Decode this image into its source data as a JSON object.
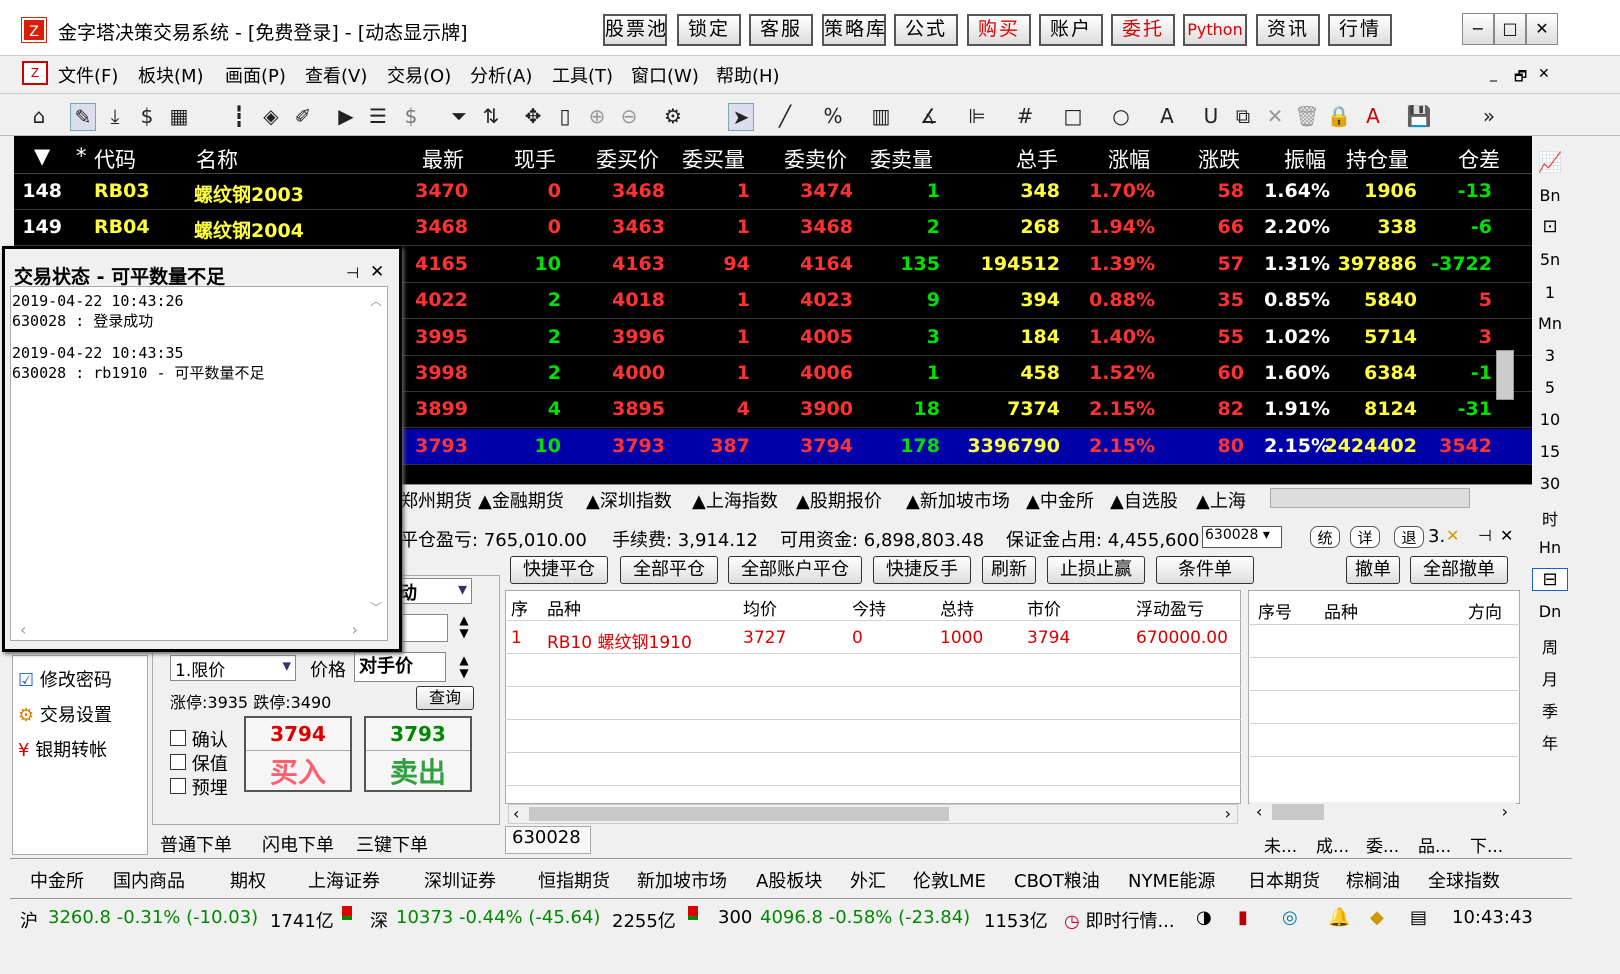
{
  "title": "金字塔决策交易系统 - [免费登录] - [动态显示牌]",
  "app_icon_glyph": "Z",
  "top_buttons": [
    "股票池",
    "锁定",
    "客服",
    "策略库",
    "公式",
    "购买",
    "账户",
    "委托",
    "Python",
    "资讯",
    "行情"
  ],
  "window_controls": [
    "−",
    "□",
    "✕"
  ],
  "menu": [
    "文件(F)",
    "板块(M)",
    "画面(P)",
    "查看(V)",
    "交易(O)",
    "分析(A)",
    "工具(T)",
    "窗口(W)",
    "帮助(H)"
  ],
  "mdi_controls": [
    "_",
    "🗗",
    "✕"
  ],
  "quote_headers": [
    "▼",
    "*",
    "代码",
    "名称",
    "最新",
    "现手",
    "委买价",
    "委买量",
    "委卖价",
    "委卖量",
    "总手",
    "涨幅",
    "涨跌",
    "振幅",
    "持仓量",
    "仓差"
  ],
  "rows": [
    {
      "idx": "148",
      "code": "RB03",
      "name": "螺纹钢2003",
      "last": "3470",
      "cur": "0",
      "bid": "3468",
      "bidv": "1",
      "ask": "3474",
      "askv": "1",
      "vol": "348",
      "chg": "1.70%",
      "diff": "58",
      "amp": "1.64%",
      "oi": "1906",
      "oid": "-13"
    },
    {
      "idx": "149",
      "code": "RB04",
      "name": "螺纹钢2004",
      "last": "3468",
      "cur": "0",
      "bid": "3463",
      "bidv": "1",
      "ask": "3468",
      "askv": "2",
      "vol": "268",
      "chg": "1.94%",
      "diff": "66",
      "amp": "2.20%",
      "oi": "338",
      "oid": "-6"
    },
    {
      "last": "4165",
      "cur": "10",
      "bid": "4163",
      "bidv": "94",
      "ask": "4164",
      "askv": "135",
      "vol": "194512",
      "chg": "1.39%",
      "diff": "57",
      "amp": "1.31%",
      "oi": "397886",
      "oid": "-3722"
    },
    {
      "last": "4022",
      "cur": "2",
      "bid": "4018",
      "bidv": "1",
      "ask": "4023",
      "askv": "9",
      "vol": "394",
      "chg": "0.88%",
      "diff": "35",
      "amp": "0.85%",
      "oi": "5840",
      "oid": "5"
    },
    {
      "last": "3995",
      "cur": "2",
      "bid": "3996",
      "bidv": "1",
      "ask": "4005",
      "askv": "3",
      "vol": "184",
      "chg": "1.40%",
      "diff": "55",
      "amp": "1.02%",
      "oi": "5714",
      "oid": "3"
    },
    {
      "last": "3998",
      "cur": "2",
      "bid": "4000",
      "bidv": "1",
      "ask": "4006",
      "askv": "1",
      "vol": "458",
      "chg": "1.52%",
      "diff": "60",
      "amp": "1.60%",
      "oi": "6384",
      "oid": "-1"
    },
    {
      "last": "3899",
      "cur": "4",
      "bid": "3895",
      "bidv": "4",
      "ask": "3900",
      "askv": "18",
      "vol": "7374",
      "chg": "2.15%",
      "diff": "82",
      "amp": "1.91%",
      "oi": "8124",
      "oid": "-31"
    },
    {
      "last": "3793",
      "cur": "10",
      "bid": "3793",
      "bidv": "387",
      "ask": "3794",
      "askv": "178",
      "vol": "3396790",
      "chg": "2.15%",
      "diff": "80",
      "amp": "2.15%",
      "oi": "2424402",
      "oid": "3542"
    }
  ],
  "sheet_tabs": [
    "郑州期货",
    "▲金融期货",
    "▲深圳指数",
    "▲上海指数",
    "▲股期报价",
    "▲新加坡市场",
    "▲中金所",
    "▲自选股",
    "▲上海"
  ],
  "popup": {
    "title": "交易状态 - 可平数量不足",
    "log": [
      "2019-04-22 10:43:26",
      "630028 : 登录成功",
      "",
      "2019-04-22 10:43:35",
      "630028 : rb1910 - 可平数量不足"
    ]
  },
  "account": {
    "close_pl": "平仓盈亏: 765,010.00",
    "fee": "手续费: 3,914.12",
    "avail": "可用资金: 6,898,803.48",
    "margin": "保证金占用: 4,455,600",
    "acct": "630028",
    "mini_buttons": [
      "统",
      "详",
      "退"
    ],
    "tail": "3."
  },
  "action_buttons": [
    "快捷平仓",
    "全部平仓",
    "全部账户平仓",
    "快捷反手",
    "刷新",
    "止损止赢",
    "条件单",
    "撤单",
    "全部撤单"
  ],
  "pos_headers": [
    "序",
    "品种",
    "均价",
    "今持",
    "总持",
    "市价",
    "浮动盈亏"
  ],
  "pos_row": [
    "1",
    "RB10 螺纹钢1910",
    "3727",
    "0",
    "1000",
    "3794",
    "670000.00"
  ],
  "ord_headers": [
    "序号",
    "品种",
    "方向"
  ],
  "ord_tabs": [
    "未...",
    "成...",
    "委...",
    "品...",
    "下..."
  ],
  "left_links": [
    "修改密码",
    "交易设置",
    "银期转帐"
  ],
  "order": {
    "mode_tail": "动",
    "type": "1.限价",
    "price_label": "价格",
    "price": "对手价",
    "limit": "涨停:3935 跌停:3490",
    "query": "查询",
    "checks": [
      "确认",
      "保值",
      "预埋"
    ],
    "buy_price": "3794",
    "buy": "买入",
    "sell_price": "3793",
    "sell": "卖出"
  },
  "order_tabs": [
    "普通下单",
    "闪电下单",
    "三键下单"
  ],
  "account_id": "630028",
  "right_periods": [
    "Bn",
    "5n",
    "1",
    "Mn",
    "3",
    "5",
    "10",
    "15",
    "30",
    "时",
    "Hn",
    "Dn",
    "周",
    "月",
    "季",
    "年"
  ],
  "markets": [
    "中金所",
    "国内商品",
    "期权",
    "上海证券",
    "深圳证券",
    "恒指期货",
    "新加坡市场",
    "A股板块",
    "外汇",
    "伦敦LME",
    "CBOT粮油",
    "NYME能源",
    "日本期货",
    "棕榈油",
    "全球指数"
  ],
  "status": {
    "sh_label": "沪",
    "sh": "3260.8 -0.31% (-10.03)",
    "sh_amt": "1741亿",
    "sz_label": "深",
    "sz": "10373 -0.44% (-45.64)",
    "sz_amt": "2255亿",
    "hs_label": "300",
    "hs": "4096.8 -0.58% (-23.84)",
    "hs_amt": "1153亿",
    "news": "即时行情...",
    "time": "10:43:43"
  },
  "colors": {
    "up": "#ff3232",
    "down": "#00e000",
    "name": "#ffff40",
    "selected_row": "#0000a8"
  }
}
